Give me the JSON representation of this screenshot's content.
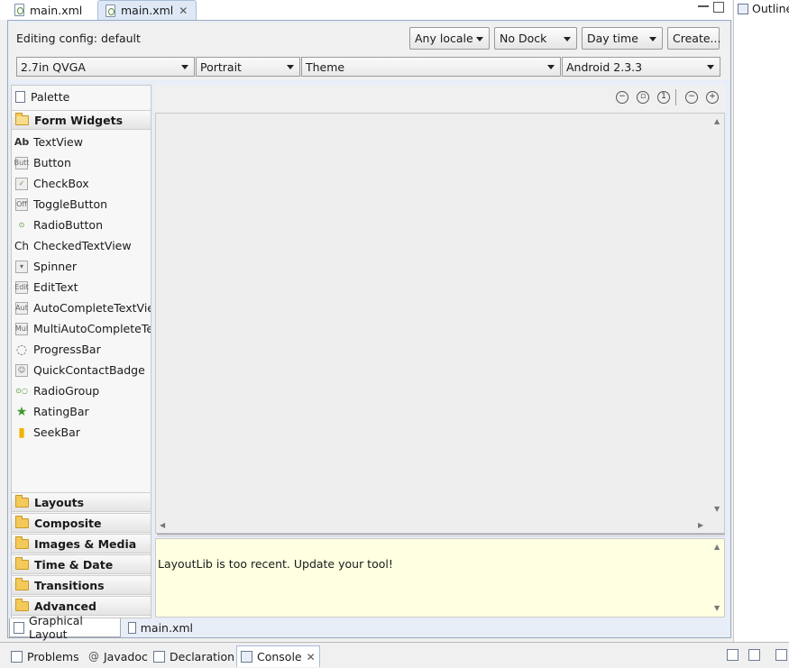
{
  "editor_tabs": [
    {
      "label": "main.xml",
      "active": false
    },
    {
      "label": "main.xml",
      "active": true
    }
  ],
  "config": {
    "editing_label": "Editing config: default",
    "locale": "Any locale",
    "dock": "No Dock",
    "time": "Day time",
    "create_button": "Create...",
    "device": "2.7in QVGA",
    "orientation": "Portrait",
    "theme": "Theme",
    "target": "Android 2.3.3"
  },
  "palette": {
    "title": "Palette",
    "open_category": "Form Widgets",
    "widgets": [
      {
        "label": "TextView",
        "icon": "textview-icon",
        "glyph": "Ab"
      },
      {
        "label": "Button",
        "icon": "button-widget-icon",
        "glyph": "Butt"
      },
      {
        "label": "CheckBox",
        "icon": "checkbox-widget-icon",
        "glyph": "✓"
      },
      {
        "label": "ToggleButton",
        "icon": "togglebutton-icon",
        "glyph": "Off"
      },
      {
        "label": "RadioButton",
        "icon": "radiobutton-icon",
        "glyph": "⊙"
      },
      {
        "label": "CheckedTextView",
        "icon": "checkedtextview-icon",
        "glyph": "Ch"
      },
      {
        "label": "Spinner",
        "icon": "spinner-icon",
        "glyph": "▾"
      },
      {
        "label": "EditText",
        "icon": "edittext-icon",
        "glyph": "Edit"
      },
      {
        "label": "AutoCompleteTextView",
        "icon": "autocomplete-icon",
        "glyph": "Aut"
      },
      {
        "label": "MultiAutoCompleteTextView",
        "icon": "multiautocomplete-icon",
        "glyph": "Mul"
      },
      {
        "label": "ProgressBar",
        "icon": "progressbar-icon",
        "glyph": "◌"
      },
      {
        "label": "QuickContactBadge",
        "icon": "quickcontactbadge-icon",
        "glyph": "☺"
      },
      {
        "label": "RadioGroup",
        "icon": "radiogroup-icon",
        "glyph": "⊙○"
      },
      {
        "label": "RatingBar",
        "icon": "ratingbar-icon",
        "glyph": "★"
      },
      {
        "label": "SeekBar",
        "icon": "seekbar-icon",
        "glyph": "▮"
      }
    ],
    "categories": [
      "Layouts",
      "Composite",
      "Images & Media",
      "Time & Date",
      "Transitions",
      "Advanced"
    ]
  },
  "zoom_controls": [
    "zoom-real-size-icon",
    "zoom-fit-icon",
    "zoom-100-icon",
    "zoom-out-icon",
    "zoom-in-icon"
  ],
  "message": "LayoutLib is too recent. Update your tool!",
  "mode_tabs": [
    {
      "label": "Graphical Layout",
      "active": true
    },
    {
      "label": "main.xml",
      "active": false
    }
  ],
  "outline": {
    "label": "Outline"
  },
  "bottom_views": [
    {
      "label": "Problems",
      "active": false
    },
    {
      "label": "Javadoc",
      "active": false
    },
    {
      "label": "Declaration",
      "active": false
    },
    {
      "label": "Console",
      "active": true
    }
  ]
}
